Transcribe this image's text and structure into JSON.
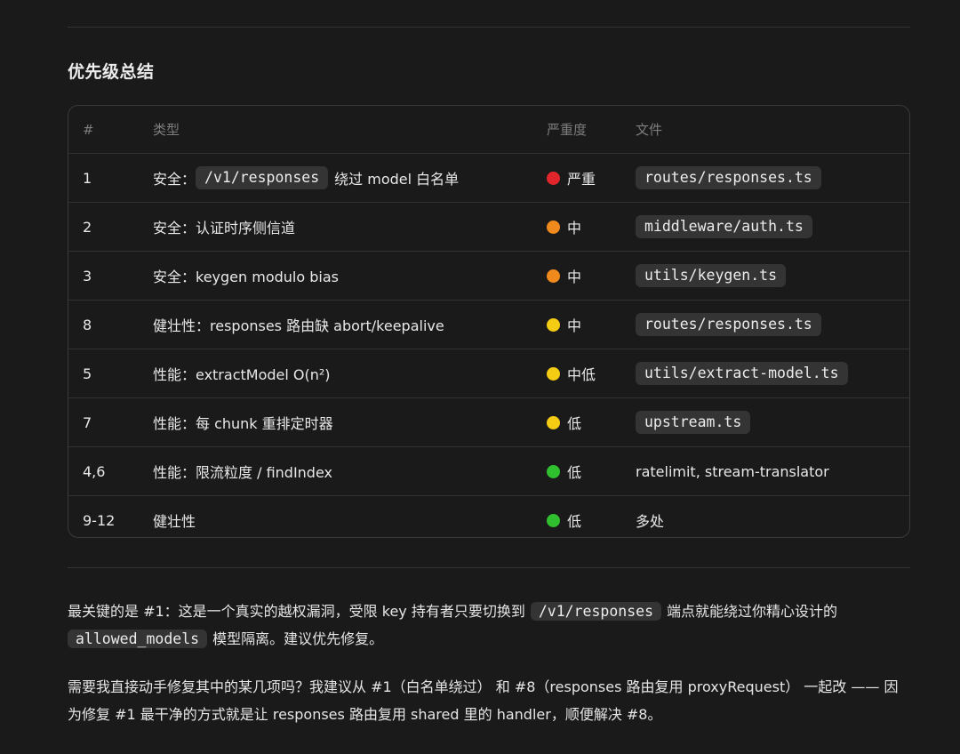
{
  "section": {
    "title": "优先级总结"
  },
  "table": {
    "headers": {
      "num": "#",
      "type": "类型",
      "severity": "严重度",
      "file": "文件"
    },
    "rows": [
      {
        "num": "1",
        "type_prefix": "安全：",
        "type_code": "/v1/responses",
        "type_suffix": "绕过 model 白名单",
        "severity": "严重",
        "severity_color": "#e0262b",
        "file": "routes/responses.ts",
        "file_is_code": true
      },
      {
        "num": "2",
        "type_prefix": "安全：认证时序侧信道",
        "type_code": "",
        "type_suffix": "",
        "severity": "中",
        "severity_color": "#f08a1c",
        "file": "middleware/auth.ts",
        "file_is_code": true
      },
      {
        "num": "3",
        "type_prefix": "安全：keygen modulo bias",
        "type_code": "",
        "type_suffix": "",
        "severity": "中",
        "severity_color": "#f08a1c",
        "file": "utils/keygen.ts",
        "file_is_code": true
      },
      {
        "num": "8",
        "type_prefix": "健壮性：responses 路由缺 abort/keepalive",
        "type_code": "",
        "type_suffix": "",
        "severity": "中",
        "severity_color": "#f5cc14",
        "file": "routes/responses.ts",
        "file_is_code": true
      },
      {
        "num": "5",
        "type_prefix": "性能：extractModel O(n²)",
        "type_code": "",
        "type_suffix": "",
        "severity": "中低",
        "severity_color": "#f5cc14",
        "file": "utils/extract-model.ts",
        "file_is_code": true
      },
      {
        "num": "7",
        "type_prefix": "性能：每 chunk 重排定时器",
        "type_code": "",
        "type_suffix": "",
        "severity": "低",
        "severity_color": "#f5cc14",
        "file": "upstream.ts",
        "file_is_code": true
      },
      {
        "num": "4,6",
        "type_prefix": "性能：限流粒度 / findIndex",
        "type_code": "",
        "type_suffix": "",
        "severity": "低",
        "severity_color": "#2fbf2f",
        "file": "ratelimit, stream-translator",
        "file_is_code": false
      },
      {
        "num": "9-12",
        "type_prefix": "健壮性",
        "type_code": "",
        "type_suffix": "",
        "severity": "低",
        "severity_color": "#2fbf2f",
        "file": "多处",
        "file_is_code": false
      }
    ]
  },
  "paragraphs": {
    "p1_a": "最关键的是 #1：这是一个真实的越权漏洞，受限 key 持有者只要切换到",
    "p1_code1": "/v1/responses",
    "p1_b": "端点就能绕过你精心设计的",
    "p1_code2": "allowed_models",
    "p1_c": "模型隔离。建议优先修复。",
    "p2": "需要我直接动手修复其中的某几项吗？我建议从 #1（白名单绕过） 和 #8（responses 路由复用 proxyRequest） 一起改 —— 因为修复 #1 最干净的方式就是让 responses 路由复用 shared 里的 handler，顺便解决 #8。"
  }
}
